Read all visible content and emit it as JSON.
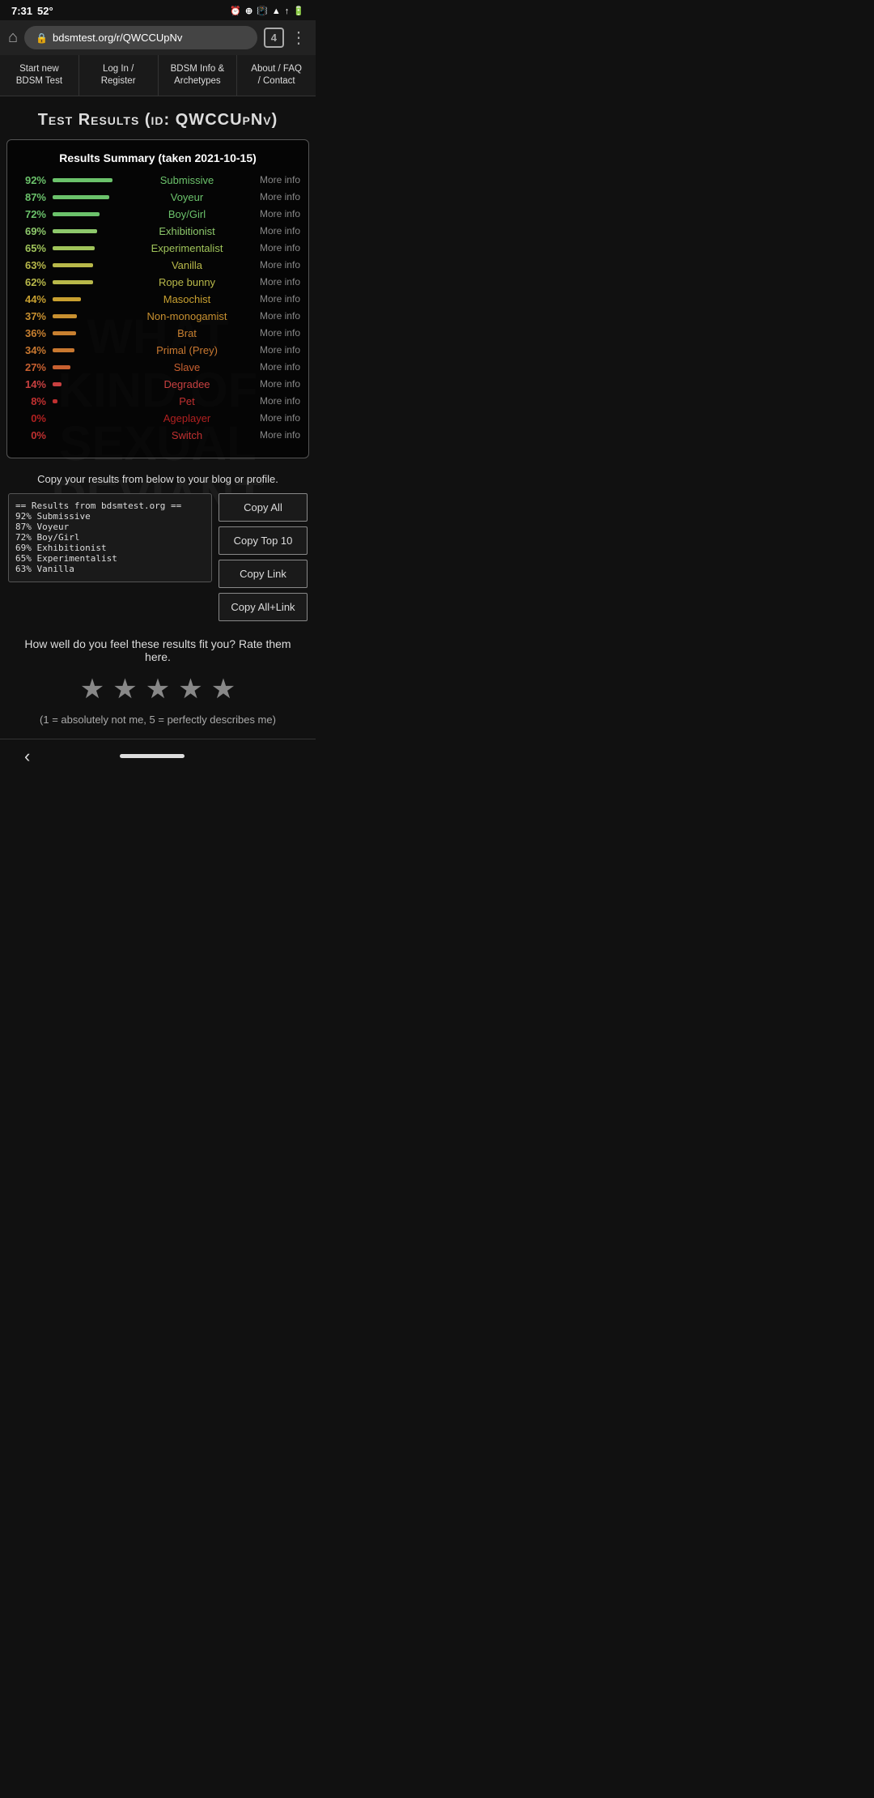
{
  "status": {
    "time": "7:31",
    "temp": "52°"
  },
  "browser": {
    "url_display": "bdsmtest.org/r/QWCCUpNv",
    "tab_count": "4"
  },
  "nav": {
    "tabs": [
      {
        "label": "Start new\nBDSM Test"
      },
      {
        "label": "Log In /\nRegister"
      },
      {
        "label": "BDSM Info &\nArchetypes"
      },
      {
        "label": "About / FAQ\n/ Contact"
      }
    ]
  },
  "page": {
    "title": "Test Results (id: QWCCUpNv)",
    "results_title": "Results Summary (taken 2021-10-15)",
    "results": [
      {
        "pct": 92,
        "label": "Submissive",
        "color": "#6bc26b"
      },
      {
        "pct": 87,
        "label": "Voyeur",
        "color": "#6bc26b"
      },
      {
        "pct": 72,
        "label": "Boy/Girl",
        "color": "#6bc26b"
      },
      {
        "pct": 69,
        "label": "Exhibitionist",
        "color": "#8dc86b"
      },
      {
        "pct": 65,
        "label": "Experimentalist",
        "color": "#a0c45a"
      },
      {
        "pct": 63,
        "label": "Vanilla",
        "color": "#b8b84a"
      },
      {
        "pct": 62,
        "label": "Rope bunny",
        "color": "#b8b84a"
      },
      {
        "pct": 44,
        "label": "Masochist",
        "color": "#c8a030"
      },
      {
        "pct": 37,
        "label": "Non-monogamist",
        "color": "#c89030"
      },
      {
        "pct": 36,
        "label": "Brat",
        "color": "#c88030"
      },
      {
        "pct": 34,
        "label": "Primal (Prey)",
        "color": "#c87830"
      },
      {
        "pct": 27,
        "label": "Slave",
        "color": "#c86030"
      },
      {
        "pct": 14,
        "label": "Degradee",
        "color": "#c84040"
      },
      {
        "pct": 8,
        "label": "Pet",
        "color": "#c03030"
      },
      {
        "pct": 0,
        "label": "Ageplayer",
        "color": "#b02020"
      },
      {
        "pct": 0,
        "label": "Switch",
        "color": "#c03030"
      }
    ],
    "more_info_label": "More info",
    "copy_instruction": "Copy your results from below to your blog or profile.",
    "copy_textarea_content": "== Results from bdsmtest.org ==\n92% Submissive\n87% Voyeur\n72% Boy/Girl\n69% Exhibitionist\n65% Experimentalist\n63% Vanilla",
    "buttons": {
      "copy_all": "Copy All",
      "copy_top10": "Copy Top 10",
      "copy_link": "Copy Link",
      "copy_all_link": "Copy All+Link"
    },
    "rating_question": "How well do you feel these results fit you? Rate them here.",
    "rating_note": "(1 = absolutely not me, 5 = perfectly describes me)"
  }
}
